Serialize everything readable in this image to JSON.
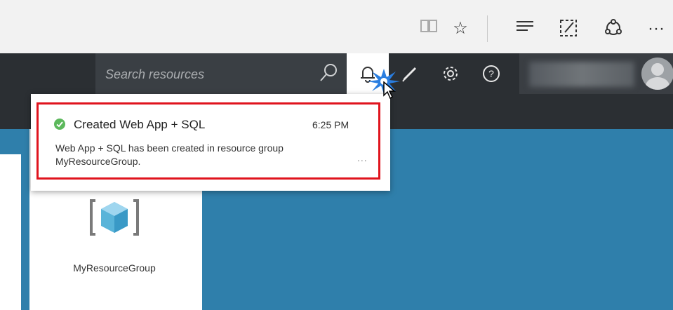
{
  "browser": {
    "icons": [
      "reading-view-icon",
      "favorite-star-icon",
      "hub-icon",
      "web-note-icon",
      "share-icon",
      "more-icon"
    ],
    "more_label": "···"
  },
  "header": {
    "search": {
      "placeholder": "Search resources",
      "value": ""
    },
    "buttons": [
      "notifications-bell-icon",
      "edit-pencil-icon",
      "settings-gear-icon",
      "help-icon"
    ]
  },
  "notification": {
    "status_icon": "success-check-icon",
    "status_color": "#5cb85c",
    "title": "Created Web App + SQL",
    "time": "6:25 PM",
    "message_line1": "Web App + SQL has been created in resource group",
    "message_line2": "MyResourceGroup.",
    "more_label": "...",
    "highlight_color": "#e0141e"
  },
  "tile": {
    "icon": "resource-group-icon",
    "label": "MyResourceGroup"
  },
  "colors": {
    "portal_header": "#2b2f33",
    "main_blue": "#2f7fab",
    "browser_bar": "#f2f2f2"
  }
}
